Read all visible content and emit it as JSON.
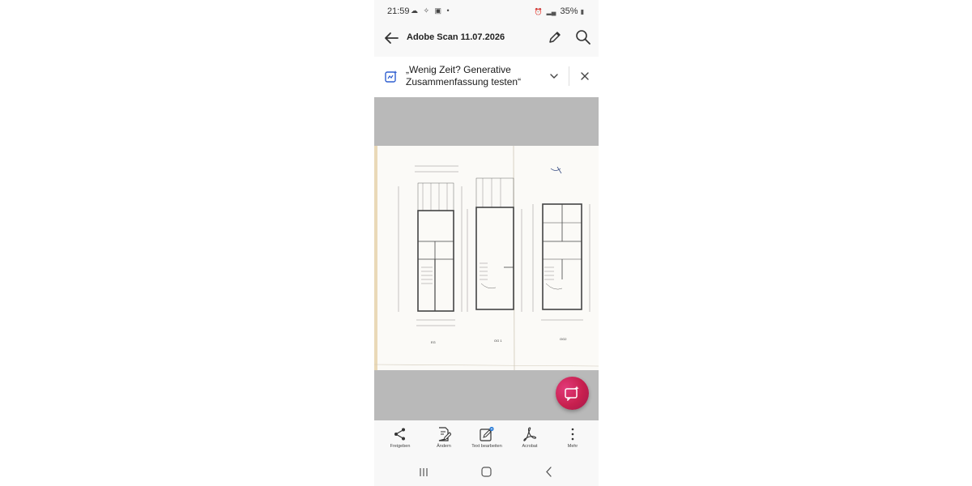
{
  "status_bar": {
    "time": "21:59",
    "battery": "35%"
  },
  "app_bar": {
    "title": "Adobe Scan 11.07.2026"
  },
  "banner": {
    "line1": "„Wenig Zeit? Generative",
    "line2": "Zusammenfassung testen“"
  },
  "scan": {
    "plan_labels": [
      "EG",
      "OG 1",
      "OG2"
    ]
  },
  "toolbar": {
    "items": [
      {
        "label": "Freigeben",
        "icon": "share-icon"
      },
      {
        "label": "Ändern",
        "icon": "modify-icon"
      },
      {
        "label": "Text bearbeiten",
        "icon": "edit-text-icon"
      },
      {
        "label": "Acrobat",
        "icon": "acrobat-icon"
      },
      {
        "label": "Mehr",
        "icon": "more-icon"
      }
    ]
  },
  "colors": {
    "accent": "#c7204e",
    "viewer_background": "#b9b9b9",
    "banner_icon": "#2f5fd0"
  }
}
